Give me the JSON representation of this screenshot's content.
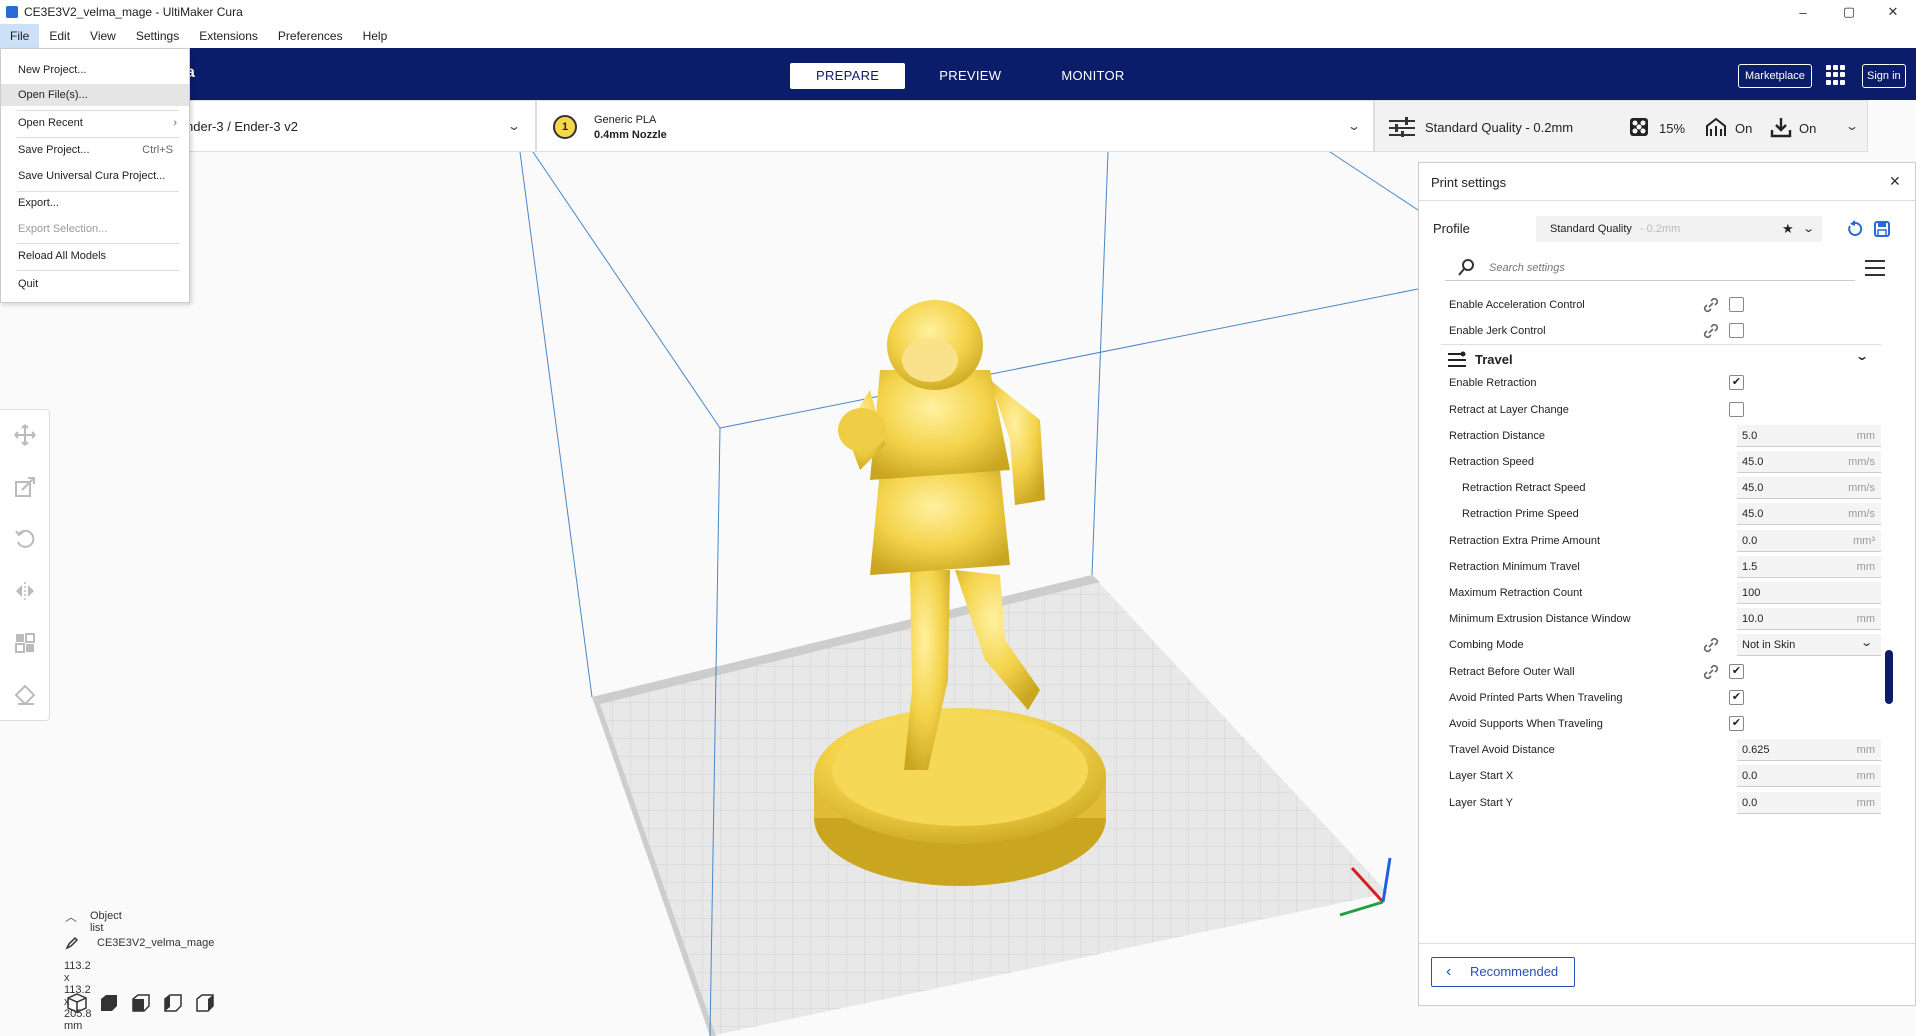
{
  "window": {
    "title": "CE3E3V2_velma_mage - UltiMaker Cura",
    "controls": [
      "–",
      "▢",
      "✕"
    ]
  },
  "menubar": [
    "File",
    "Edit",
    "View",
    "Settings",
    "Extensions",
    "Preferences",
    "Help"
  ],
  "file_menu": {
    "items": [
      {
        "label": "New Project...",
        "shortcut": ""
      },
      {
        "label": "Open File(s)...",
        "shortcut": ""
      },
      {
        "label": "Open Recent",
        "shortcut": "›"
      },
      {
        "label": "Save Project...",
        "shortcut": "Ctrl+S"
      },
      {
        "label": "Save Universal Cura Project...",
        "shortcut": ""
      },
      {
        "label": "Export...",
        "shortcut": ""
      },
      {
        "label": "Export Selection...",
        "shortcut": ""
      },
      {
        "label": "Reload All Models",
        "shortcut": ""
      },
      {
        "label": "Quit",
        "shortcut": ""
      }
    ]
  },
  "stages": [
    "PREPARE",
    "PREVIEW",
    "MONITOR"
  ],
  "header": {
    "marketplace": "Marketplace",
    "signin": "Sign in",
    "logo_fragment": "a"
  },
  "printer": {
    "name": "nder-3 / Ender-3 v2"
  },
  "material": {
    "badge": "1",
    "material": "Generic PLA",
    "nozzle": "0.4mm Nozzle"
  },
  "print_summary": {
    "profile": "Standard Quality - 0.2mm",
    "infill": "15%",
    "support": "On",
    "adhesion": "On"
  },
  "panel": {
    "title": "Print settings",
    "profile_label": "Profile",
    "profile_value": "Standard Quality",
    "profile_sub": "- 0.2mm",
    "search_placeholder": "Search settings",
    "recommended": "Recommended",
    "category_travel": "Travel",
    "rows": [
      {
        "name": "Enable Acceleration Control",
        "type": "check",
        "checked": false,
        "link": true
      },
      {
        "name": "Enable Jerk Control",
        "type": "check",
        "checked": false,
        "link": true
      },
      {
        "name": "Enable Retraction",
        "type": "check",
        "checked": true,
        "link": false
      },
      {
        "name": "Retract at Layer Change",
        "type": "check",
        "checked": false,
        "link": false
      },
      {
        "name": "Retraction Distance",
        "type": "field",
        "value": "5.0",
        "unit": "mm"
      },
      {
        "name": "Retraction Speed",
        "type": "field",
        "value": "45.0",
        "unit": "mm/s"
      },
      {
        "name": "Retraction Retract Speed",
        "type": "field",
        "value": "45.0",
        "unit": "mm/s",
        "child": true
      },
      {
        "name": "Retraction Prime Speed",
        "type": "field",
        "value": "45.0",
        "unit": "mm/s",
        "child": true
      },
      {
        "name": "Retraction Extra Prime Amount",
        "type": "field",
        "value": "0.0",
        "unit": "mm³"
      },
      {
        "name": "Retraction Minimum Travel",
        "type": "field",
        "value": "1.5",
        "unit": "mm"
      },
      {
        "name": "Maximum Retraction Count",
        "type": "field",
        "value": "100",
        "unit": ""
      },
      {
        "name": "Minimum Extrusion Distance Window",
        "type": "field",
        "value": "10.0",
        "unit": "mm"
      },
      {
        "name": "Combing Mode",
        "type": "select",
        "value": "Not in Skin",
        "link": true
      },
      {
        "name": "Retract Before Outer Wall",
        "type": "check",
        "checked": true,
        "link": true
      },
      {
        "name": "Avoid Printed Parts When Traveling",
        "type": "check",
        "checked": true,
        "link": false
      },
      {
        "name": "Avoid Supports When Traveling",
        "type": "check",
        "checked": true,
        "link": false
      },
      {
        "name": "Travel Avoid Distance",
        "type": "field",
        "value": "0.625",
        "unit": "mm"
      },
      {
        "name": "Layer Start X",
        "type": "field",
        "value": "0.0",
        "unit": "mm"
      },
      {
        "name": "Layer Start Y",
        "type": "field",
        "value": "0.0",
        "unit": "mm"
      }
    ]
  },
  "objects": {
    "header": "Object list",
    "name": "CE3E3V2_velma_mage",
    "dimensions": "113.2 x 113.2 x 205.8 mm"
  },
  "colors": {
    "header": "#0b1c6b",
    "model": "#f6d64d",
    "accent": "#2a4fb8"
  }
}
